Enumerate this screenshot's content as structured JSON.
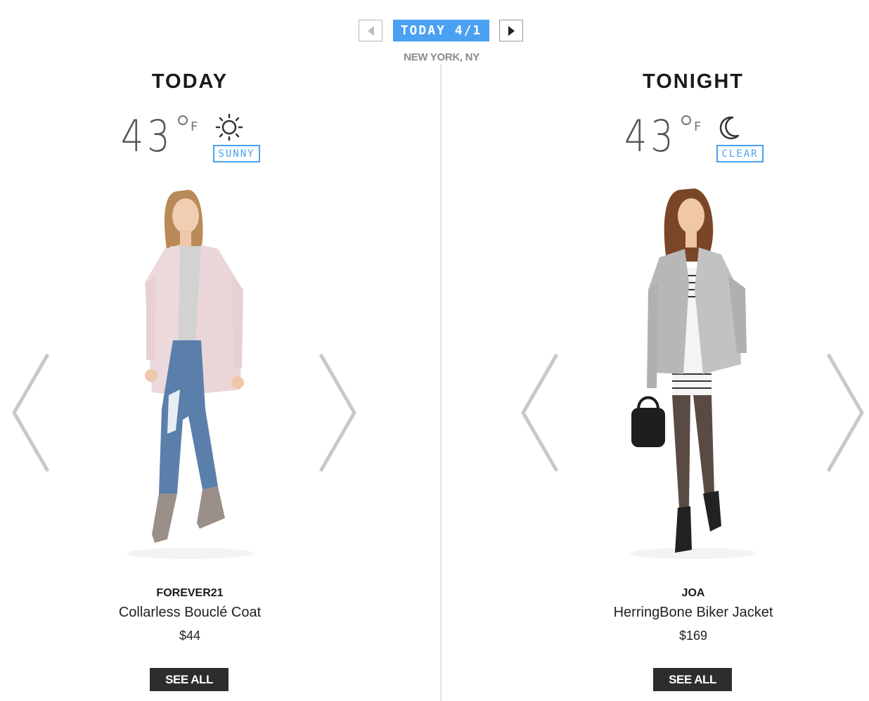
{
  "date_nav": {
    "label": "TODAY 4/1",
    "location": "NEW YORK, NY",
    "prev_icon": "arrow-left-icon",
    "next_icon": "arrow-right-icon"
  },
  "panels": [
    {
      "heading": "TODAY",
      "temperature": "43",
      "unit": "F",
      "weather_icon": "sun-icon",
      "condition": "SUNNY",
      "product": {
        "brand": "FOREVER21",
        "name": "Collarless Bouclé Coat",
        "price": "$44"
      },
      "see_all_label": "SEE ALL"
    },
    {
      "heading": "TONIGHT",
      "temperature": "43",
      "unit": "F",
      "weather_icon": "moon-icon",
      "condition": "CLEAR",
      "product": {
        "brand": "JOA",
        "name": "HerringBone Biker Jacket",
        "price": "$169"
      },
      "see_all_label": "SEE ALL"
    }
  ],
  "colors": {
    "accent": "#4aa1f2",
    "button_dark": "#2d2d2d",
    "chevron": "#c8c8c8"
  }
}
